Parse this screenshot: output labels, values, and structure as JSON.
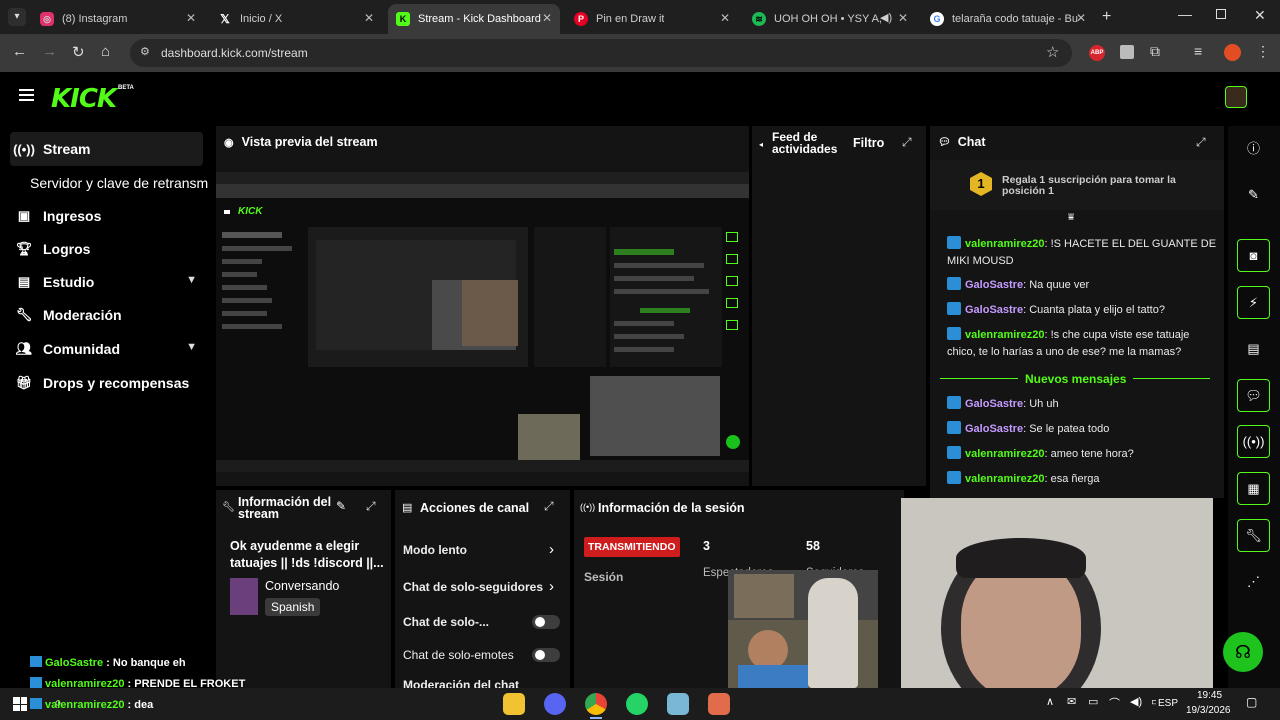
{
  "browser": {
    "tabs": [
      {
        "title": "(8) Instagram",
        "icon": "instagram-icon",
        "color": "#e1306c"
      },
      {
        "title": "Inicio / X",
        "icon": "x-icon",
        "color": "#000000"
      },
      {
        "title": "Stream - Kick Dashboard",
        "icon": "kick-icon",
        "color": "#53fc18"
      },
      {
        "title": "Pin en Draw it",
        "icon": "pinterest-icon",
        "color": "#e60023"
      },
      {
        "title": "UOH OH OH • YSY A, S",
        "icon": "spotify-icon",
        "color": "#1db954"
      },
      {
        "title": "telaraña codo tatuaje - Bu",
        "icon": "google-icon",
        "color": "#4285f4"
      }
    ],
    "url": "dashboard.kick.com/stream",
    "ext_abp": "ABP"
  },
  "kick": {
    "logo": "KICK",
    "beta": "BETA"
  },
  "sidebar": {
    "items": [
      {
        "label": "Stream",
        "icon": "broadcast-icon"
      },
      {
        "label": "Servidor y clave de retransm"
      },
      {
        "label": "Ingresos",
        "icon": "wallet-icon"
      },
      {
        "label": "Logros",
        "icon": "trophy-icon"
      },
      {
        "label": "Estudio",
        "icon": "studio-icon"
      },
      {
        "label": "Moderación",
        "icon": "wrench-icon"
      },
      {
        "label": "Comunidad",
        "icon": "users-icon"
      },
      {
        "label": "Drops y recompensas",
        "icon": "gift-icon"
      }
    ]
  },
  "preview": {
    "title": "Vista previa del stream"
  },
  "feed": {
    "title": "Feed de actividades",
    "filter": "Filtro"
  },
  "chat": {
    "title": "Chat",
    "gift_rank": "1",
    "gift_text": "Regala 1 suscripción para tomar la posición 1",
    "new_messages": "Nuevos mensajes",
    "messages": [
      {
        "user": "valenramirez20",
        "text": ": !S HACETE EL DEL GUANTE DE MIKI MOUSD",
        "color": "green"
      },
      {
        "user": "GaloSastre",
        "text": ": Na quue ver",
        "color": "purple"
      },
      {
        "user": "GaloSastre",
        "text": ": Cuanta plata y elijo el tatto?",
        "color": "purple"
      },
      {
        "user": "valenramirez20",
        "text": ": !s che cupa viste ese tatuaje chico, te lo harías a uno de ese? me la mamas?",
        "color": "green"
      },
      {
        "user": "GaloSastre",
        "text": ": Uh uh",
        "color": "purple"
      },
      {
        "user": "GaloSastre",
        "text": ": Se le patea todo",
        "color": "purple"
      },
      {
        "user": "valenramirez20",
        "text": ": ameo tene hora?",
        "color": "green"
      },
      {
        "user": "valenramirez20",
        "text": ": esa ñerga",
        "color": "green"
      }
    ]
  },
  "stream_info": {
    "title": "Información del stream",
    "stream_title": "Ok ayudenme a elegir tatuajes || !ds !discord ||...",
    "category": "Conversando",
    "language": "Spanish"
  },
  "channel_actions": {
    "title": "Acciones de canal",
    "slow_mode": "Modo lento",
    "followers_only": "Chat de solo-seguidores",
    "subs_only": "Chat de solo-...",
    "emotes_only": "Chat de solo-emotes",
    "moderation": "Moderación del chat"
  },
  "session": {
    "title": "Información de la sesión",
    "status": "TRANSMITIENDO",
    "session_label": "Sesión",
    "viewers": "3",
    "viewers_label": "Espectadores",
    "followers": "58",
    "followers_label": "Seguidores"
  },
  "overlay_chat": [
    {
      "user": "GaloSastre",
      "text": " : No banque eh"
    },
    {
      "user": "valenramirez20",
      "text": " : PRENDE EL FROKET"
    },
    {
      "user": "valenramirez20",
      "text": " : dea"
    }
  ],
  "taskbar": {
    "lang": "ESP",
    "time": "19:45",
    "date": "19/3/2026"
  }
}
